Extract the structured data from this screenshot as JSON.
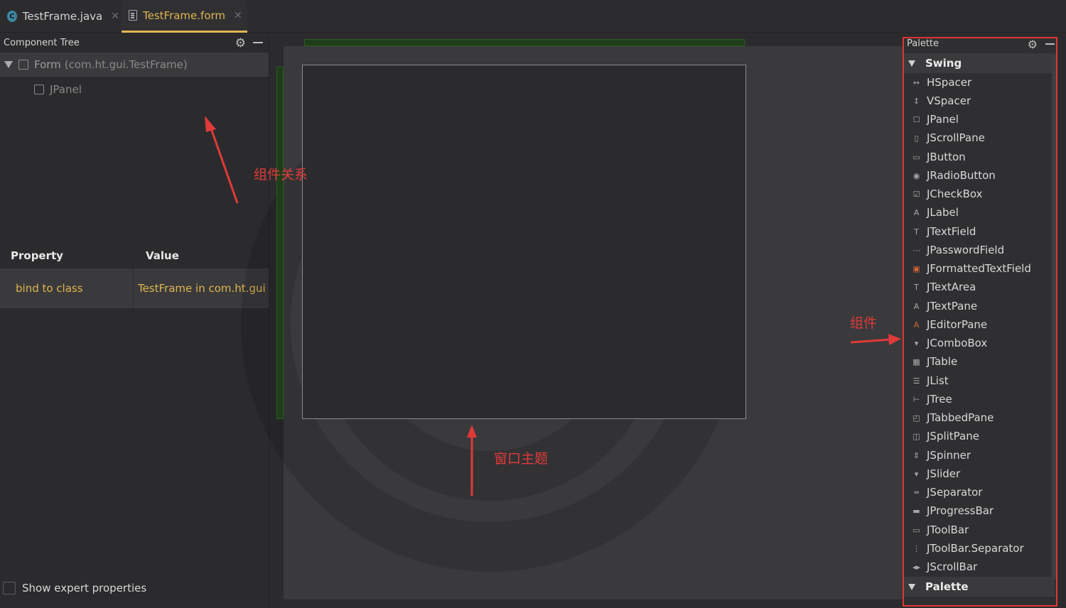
{
  "tabs": [
    {
      "label": "TestFrame.java",
      "icon": "java-class-icon",
      "active": false
    },
    {
      "label": "TestFrame.form",
      "icon": "form-file-icon",
      "active": true
    }
  ],
  "component_tree": {
    "title": "Component Tree",
    "items": [
      {
        "label": "Form",
        "detail": "(com.ht.gui.TestFrame)"
      },
      {
        "label": "JPanel"
      }
    ]
  },
  "properties": {
    "header_property": "Property",
    "header_value": "Value",
    "rows": [
      {
        "name": "bind to class",
        "value": "TestFrame in com.ht.gui"
      }
    ],
    "expert_label": "Show expert properties"
  },
  "annotations": {
    "tree": "组件关系",
    "window": "窗口主题",
    "components": "组件"
  },
  "palette": {
    "title": "Palette",
    "group_swing": "Swing",
    "group_palette": "Palette",
    "items": [
      {
        "label": "HSpacer",
        "icon": "hspacer-icon"
      },
      {
        "label": "VSpacer",
        "icon": "vspacer-icon"
      },
      {
        "label": "JPanel",
        "icon": "panel-icon"
      },
      {
        "label": "JScrollPane",
        "icon": "scrollpane-icon"
      },
      {
        "label": "JButton",
        "icon": "button-icon"
      },
      {
        "label": "JRadioButton",
        "icon": "radio-icon"
      },
      {
        "label": "JCheckBox",
        "icon": "checkbox-icon"
      },
      {
        "label": "JLabel",
        "icon": "label-icon"
      },
      {
        "label": "JTextField",
        "icon": "textfield-icon"
      },
      {
        "label": "JPasswordField",
        "icon": "password-icon"
      },
      {
        "label": "JFormattedTextField",
        "icon": "formatted-icon"
      },
      {
        "label": "JTextArea",
        "icon": "textarea-icon"
      },
      {
        "label": "JTextPane",
        "icon": "textpane-icon"
      },
      {
        "label": "JEditorPane",
        "icon": "editorpane-icon"
      },
      {
        "label": "JComboBox",
        "icon": "combobox-icon"
      },
      {
        "label": "JTable",
        "icon": "table-icon"
      },
      {
        "label": "JList",
        "icon": "list-icon"
      },
      {
        "label": "JTree",
        "icon": "tree-icon"
      },
      {
        "label": "JTabbedPane",
        "icon": "tabbedpane-icon"
      },
      {
        "label": "JSplitPane",
        "icon": "splitpane-icon"
      },
      {
        "label": "JSpinner",
        "icon": "spinner-icon"
      },
      {
        "label": "JSlider",
        "icon": "slider-icon"
      },
      {
        "label": "JSeparator",
        "icon": "separator-icon"
      },
      {
        "label": "JProgressBar",
        "icon": "progressbar-icon"
      },
      {
        "label": "JToolBar",
        "icon": "toolbar-icon"
      },
      {
        "label": "JToolBar.Separator",
        "icon": "toolbar-separator-icon"
      },
      {
        "label": "JScrollBar",
        "icon": "scrollbar-icon"
      }
    ]
  },
  "colors": {
    "accent": "#e0b550",
    "annotation": "#e03a3a",
    "background": "#2b2b2d"
  }
}
